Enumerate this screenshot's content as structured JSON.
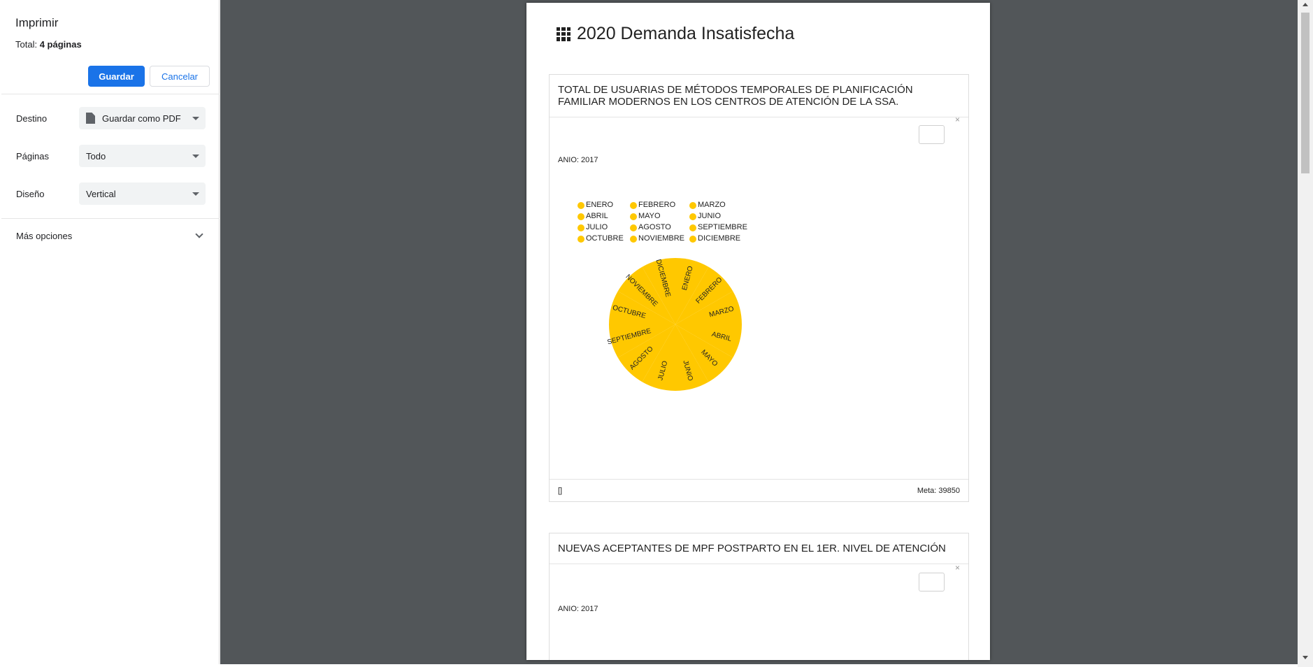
{
  "print_panel": {
    "title": "Imprimir",
    "total_label": "Total:",
    "total_value": "4 páginas",
    "save_button": "Guardar",
    "cancel_button": "Cancelar",
    "destination": {
      "label": "Destino",
      "value": "Guardar como PDF"
    },
    "pages": {
      "label": "Páginas",
      "value": "Todo"
    },
    "layout": {
      "label": "Diseño",
      "value": "Vertical"
    },
    "more_options": "Más opciones"
  },
  "sheet": {
    "title": "2020 Demanda Insatisfecha",
    "cards": [
      {
        "heading": "TOTAL DE USUARIAS DE MÉTODOS TEMPORALES DE PLANIFICACIÓN FAMILIAR MODERNOS EN LOS CENTROS DE ATENCIÓN DE LA SSA.",
        "close": "×",
        "year_label": "ANIO: 2017",
        "footer_left": "[]",
        "footer_right": "Meta: 39850"
      },
      {
        "heading": "NUEVAS ACEPTANTES DE MPF POSTPARTO EN EL 1ER. NIVEL DE ATENCIÓN",
        "close": "×",
        "year_label": "ANIO: 2017"
      }
    ]
  },
  "chart_data": {
    "type": "pie",
    "categories": [
      "ENERO",
      "FEBRERO",
      "MARZO",
      "ABRIL",
      "MAYO",
      "JUNIO",
      "JULIO",
      "AGOSTO",
      "SEPTIEMBRE",
      "OCTUBRE",
      "NOVIEMBRE",
      "DICIEMBRE"
    ],
    "values": [
      1,
      1,
      1,
      1,
      1,
      1,
      1,
      1,
      1,
      1,
      1,
      1
    ],
    "color": "#FFC800",
    "legend_position": "top-left"
  }
}
